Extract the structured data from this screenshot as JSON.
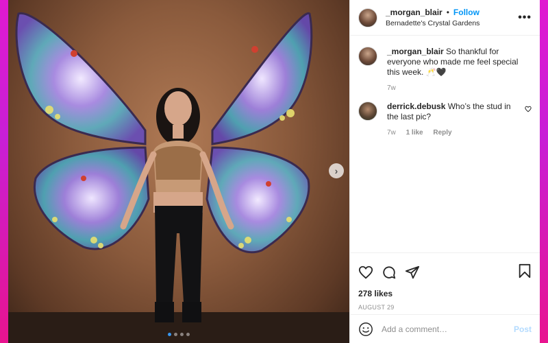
{
  "post": {
    "carousel": {
      "dot_count": 4,
      "active_index": 0,
      "next_symbol": "›"
    },
    "header": {
      "username": "_morgan_blair",
      "separator": "•",
      "follow_label": "Follow",
      "location": "Bernadette's Crystal Gardens",
      "more_symbol": "•••"
    },
    "comments": [
      {
        "username": "_morgan_blair",
        "text": "So thankful for everyone who made me feel special this week. 🥂🖤",
        "time": "7w"
      },
      {
        "username": "derrick.debusk",
        "text": "Who’s the stud in the last pic?",
        "time": "7w",
        "likes": "1 like",
        "reply_label": "Reply"
      }
    ],
    "likes": "278 likes",
    "date": "AUGUST 29",
    "add_comment": {
      "placeholder": "Add a comment…",
      "post_label": "Post"
    },
    "icons": [
      "heart-icon",
      "comment-icon",
      "share-icon",
      "bookmark-icon",
      "emoji-icon"
    ],
    "colors": {
      "accent": "#0095f6",
      "post_disabled": "#b3dbff",
      "background_gradient_top": "#e01ad0",
      "background_gradient_bottom": "#e8148f"
    }
  }
}
